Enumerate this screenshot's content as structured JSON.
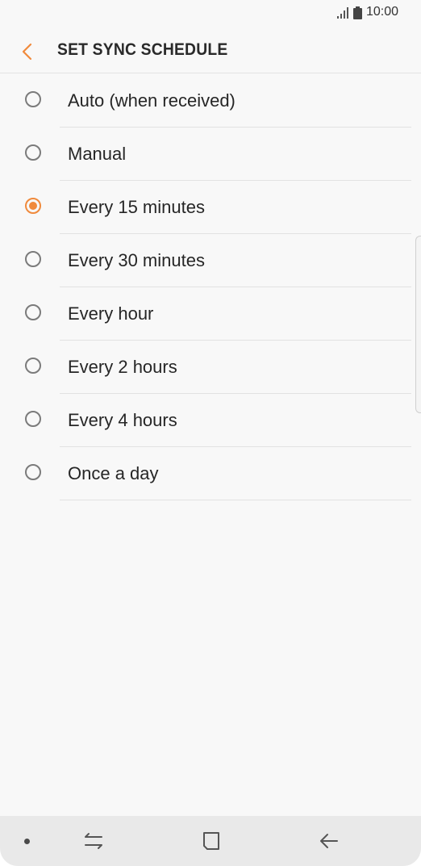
{
  "status_bar": {
    "time": "10:00",
    "icons": [
      "signal-icon",
      "battery-icon"
    ]
  },
  "header": {
    "title": "SET SYNC SCHEDULE",
    "back_icon": "chevron-left-icon"
  },
  "colors": {
    "accent": "#f08a3c",
    "background": "#f8f8f8",
    "nav_bar": "#e9e9e9"
  },
  "options": [
    {
      "label": "Auto (when received)",
      "selected": false
    },
    {
      "label": "Manual",
      "selected": false
    },
    {
      "label": "Every 15 minutes",
      "selected": true
    },
    {
      "label": "Every 30 minutes",
      "selected": false
    },
    {
      "label": "Every hour",
      "selected": false
    },
    {
      "label": "Every 2 hours",
      "selected": false
    },
    {
      "label": "Every 4 hours",
      "selected": false
    },
    {
      "label": "Once a day",
      "selected": false
    }
  ],
  "nav_bar": {
    "buttons": [
      "recents-icon",
      "home-icon",
      "back-arrow-icon"
    ]
  }
}
